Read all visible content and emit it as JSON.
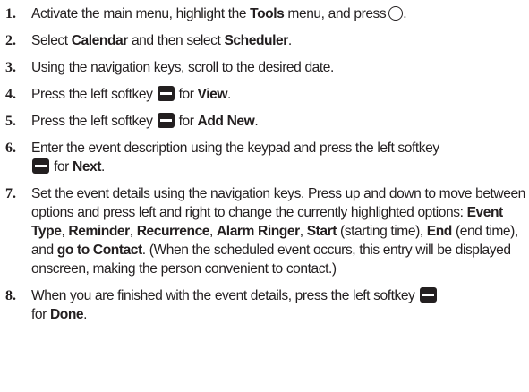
{
  "steps": [
    {
      "number": "1.",
      "t1": "Activate the main menu, highlight the ",
      "b1": "Tools",
      "t2": " menu, and press",
      "t3": "."
    },
    {
      "number": "2.",
      "t1": "Select ",
      "b1": "Calendar",
      "t2": " and then select ",
      "b2": "Scheduler",
      "t3": "."
    },
    {
      "number": "3.",
      "t1": "Using the navigation keys, scroll to the desired date."
    },
    {
      "number": "4.",
      "t1": "Press the left softkey",
      "t2": " for ",
      "b1": "View",
      "t3": "."
    },
    {
      "number": "5.",
      "t1": "Press the left softkey",
      "t2": " for ",
      "b1": "Add New",
      "t3": "."
    },
    {
      "number": "6.",
      "t1": "Enter the event description using the keypad and press the left softkey",
      "t2": " for ",
      "b1": "Next",
      "t3": "."
    },
    {
      "number": "7.",
      "t1": "Set the event details using the navigation keys. Press up and down to move between options and press left and right to change the currently highlighted options: ",
      "b1": "Event Type",
      "s1": ", ",
      "b2": "Reminder",
      "s2": ", ",
      "b3": "Recurrence",
      "s3": ", ",
      "b4": "Alarm Ringer",
      "s4": ", ",
      "b5": "Start",
      "s5": " (starting time), ",
      "b6": "End",
      "s6": " (end time), and ",
      "b7": "go to Contact",
      "s7": ". (When the scheduled event occurs, this entry will be displayed onscreen, making the person convenient to contact.)"
    },
    {
      "number": "8.",
      "t1": "When you are finished with the event details, press the left softkey",
      "t2": "for ",
      "b1": "Done",
      "t3": "."
    }
  ],
  "icons": {
    "ok_key": "ok-circle-icon",
    "left_softkey": "left-softkey-icon"
  },
  "colors": {
    "text": "#231f20",
    "background": "#ffffff"
  }
}
